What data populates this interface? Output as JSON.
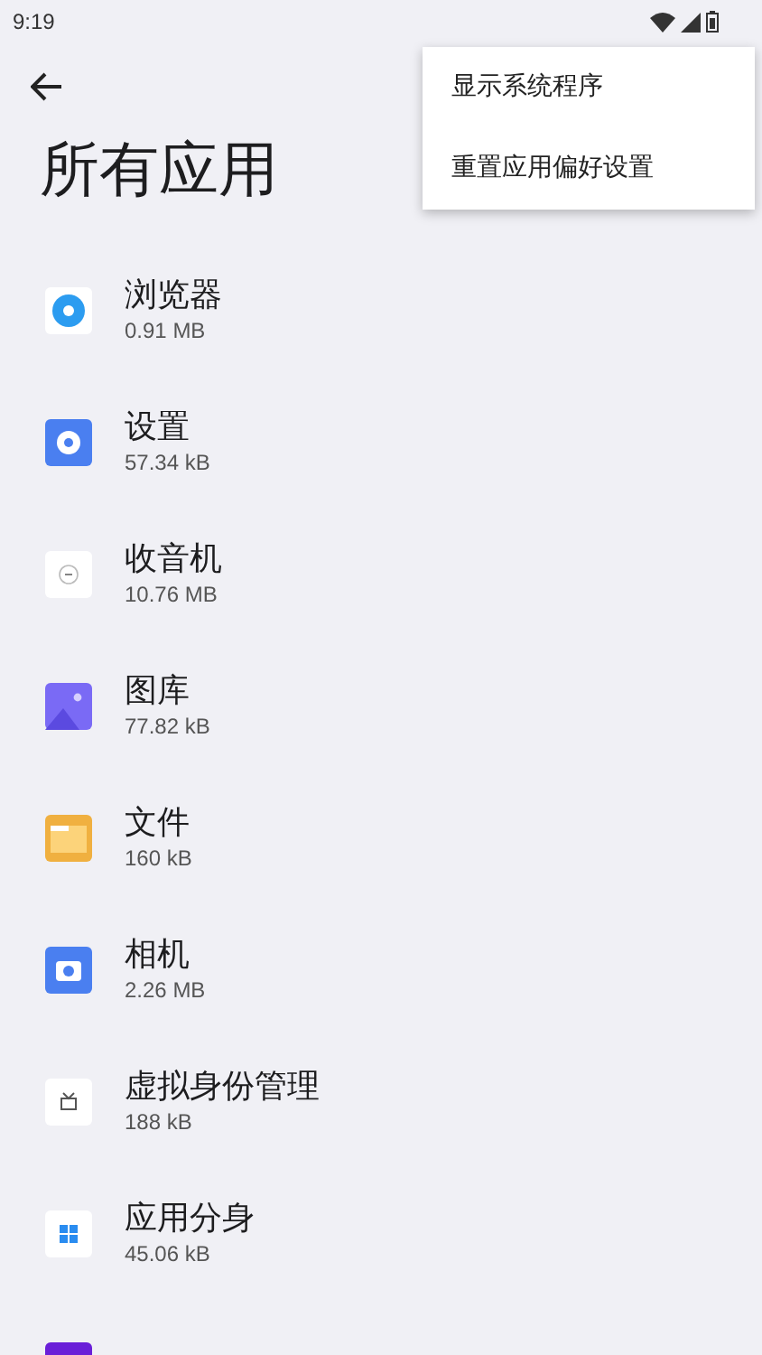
{
  "status_bar": {
    "time": "9:19"
  },
  "title": "所有应用",
  "menu": {
    "items": [
      "显示系统程序",
      "重置应用偏好设置"
    ]
  },
  "apps": [
    {
      "name": "浏览器",
      "size": "0.91 MB",
      "kind": "browser"
    },
    {
      "name": "设置",
      "size": "57.34 kB",
      "kind": "settings"
    },
    {
      "name": "收音机",
      "size": "10.76 MB",
      "kind": "radio"
    },
    {
      "name": "图库",
      "size": "77.82 kB",
      "kind": "gallery"
    },
    {
      "name": "文件",
      "size": "160 kB",
      "kind": "files"
    },
    {
      "name": "相机",
      "size": "2.26 MB",
      "kind": "camera"
    },
    {
      "name": "虚拟身份管理",
      "size": "188 kB",
      "kind": "identity"
    },
    {
      "name": "应用分身",
      "size": "45.06 kB",
      "kind": "clone"
    },
    {
      "kind": "game"
    }
  ]
}
